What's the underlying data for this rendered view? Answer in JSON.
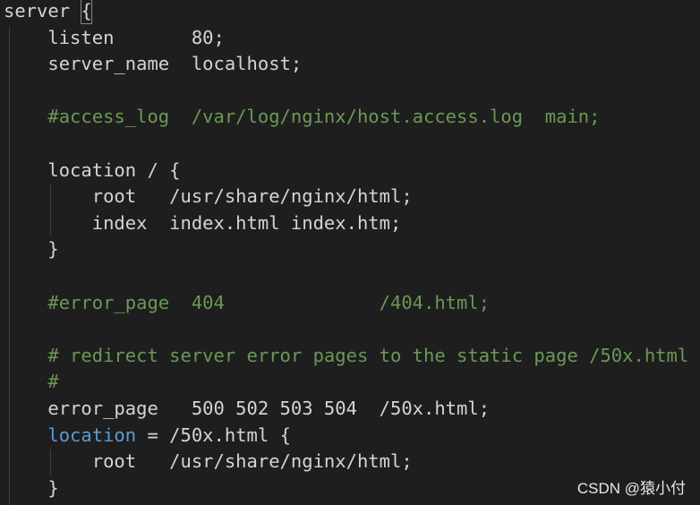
{
  "colors": {
    "background": "#1e1e1e",
    "default_text": "#d4d4d4",
    "comment": "#6a9955",
    "keyword": "#569cd6",
    "indent_guide": "#404040"
  },
  "lines": [
    [
      {
        "t": "server ",
        "c": "default"
      },
      {
        "t": "{",
        "c": "default",
        "box": true
      }
    ],
    [
      {
        "t": "    listen       80;",
        "c": "default"
      }
    ],
    [
      {
        "t": "    server_name  localhost;",
        "c": "default"
      }
    ],
    [
      {
        "t": "",
        "c": "default"
      }
    ],
    [
      {
        "t": "    #access_log  /var/log/nginx/host.access.log  main;",
        "c": "comment"
      }
    ],
    [
      {
        "t": "",
        "c": "default"
      }
    ],
    [
      {
        "t": "    location / {",
        "c": "default"
      }
    ],
    [
      {
        "t": "        root   /usr/share/nginx/html;",
        "c": "default"
      }
    ],
    [
      {
        "t": "        index  index.html index.htm;",
        "c": "default"
      }
    ],
    [
      {
        "t": "    }",
        "c": "default"
      }
    ],
    [
      {
        "t": "",
        "c": "default"
      }
    ],
    [
      {
        "t": "    #error_page  404              /404.html;",
        "c": "comment"
      }
    ],
    [
      {
        "t": "",
        "c": "default"
      }
    ],
    [
      {
        "t": "    # redirect server error pages to the static page /50x.html",
        "c": "comment"
      }
    ],
    [
      {
        "t": "    #",
        "c": "comment"
      }
    ],
    [
      {
        "t": "    error_page   500 502 503 504  /50x.html;",
        "c": "default"
      }
    ],
    [
      {
        "t": "    ",
        "c": "default"
      },
      {
        "t": "location",
        "c": "keyword"
      },
      {
        "t": " = /50x.html {",
        "c": "default"
      }
    ],
    [
      {
        "t": "        root   /usr/share/nginx/html;",
        "c": "default"
      }
    ],
    [
      {
        "t": "    }",
        "c": "default"
      }
    ]
  ],
  "watermark": "CSDN @猿小付"
}
